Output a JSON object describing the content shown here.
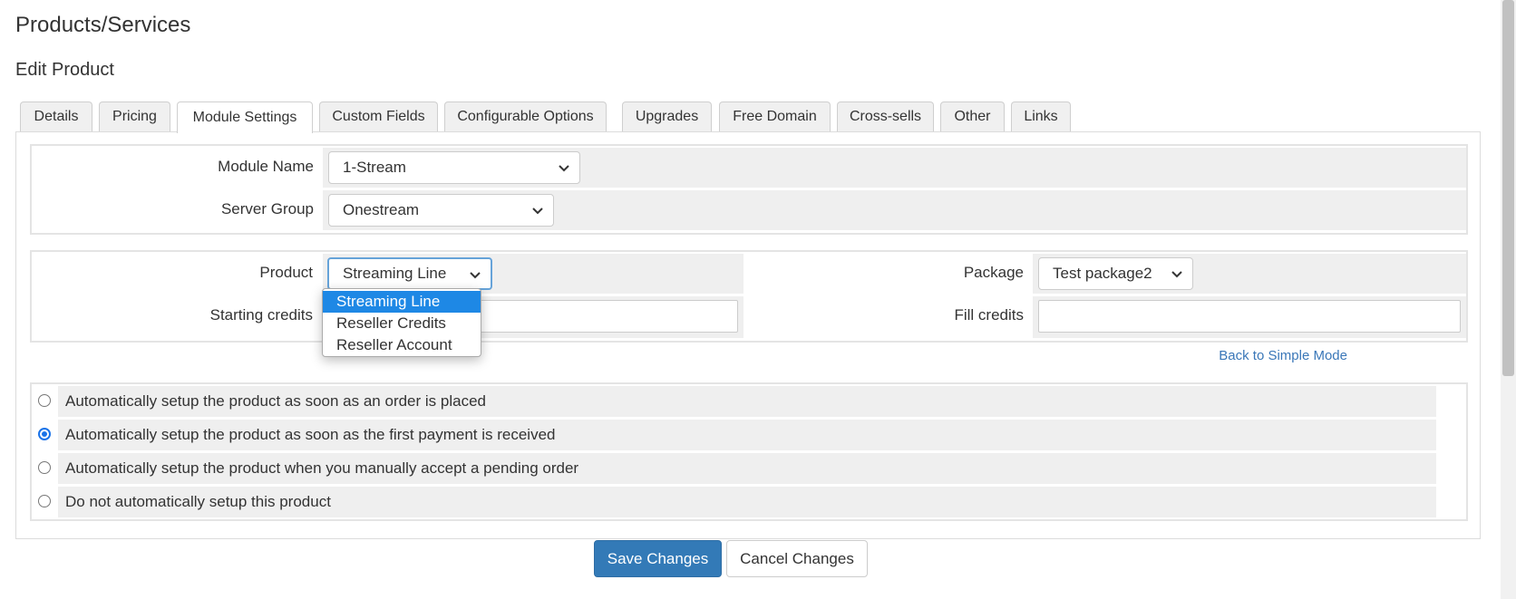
{
  "page": {
    "title": "Products/Services",
    "subtitle": "Edit Product"
  },
  "tabs": [
    {
      "label": "Details"
    },
    {
      "label": "Pricing"
    },
    {
      "label": "Module Settings",
      "active": true
    },
    {
      "label": "Custom Fields"
    },
    {
      "label": "Configurable Options"
    },
    {
      "label": "Upgrades"
    },
    {
      "label": "Free Domain"
    },
    {
      "label": "Cross-sells"
    },
    {
      "label": "Other"
    },
    {
      "label": "Links"
    }
  ],
  "module": {
    "module_name_label": "Module Name",
    "module_name_value": "1-Stream",
    "server_group_label": "Server Group",
    "server_group_value": "Onestream"
  },
  "config": {
    "product_label": "Product",
    "product_value": "Streaming Line",
    "product_options": [
      "Streaming Line",
      "Reseller Credits",
      "Reseller Account"
    ],
    "starting_credits_label": "Starting credits",
    "starting_credits_value": "",
    "package_label": "Package",
    "package_value": "Test package2",
    "fill_credits_label": "Fill credits",
    "fill_credits_value": ""
  },
  "back_link": "Back to Simple Mode",
  "setup_options": [
    {
      "label": "Automatically setup the product as soon as an order is placed",
      "checked": false
    },
    {
      "label": "Automatically setup the product as soon as the first payment is received",
      "checked": true
    },
    {
      "label": "Automatically setup the product when you manually accept a pending order",
      "checked": false
    },
    {
      "label": "Do not automatically setup this product",
      "checked": false
    }
  ],
  "buttons": {
    "save": "Save Changes",
    "cancel": "Cancel Changes"
  },
  "colors": {
    "primary": "#337ab7",
    "link": "#3a77b8",
    "selected_option": "#1e88e5",
    "radio": "#1a73e8"
  },
  "icons": {
    "select_arrow": "chevron-down-icon"
  }
}
